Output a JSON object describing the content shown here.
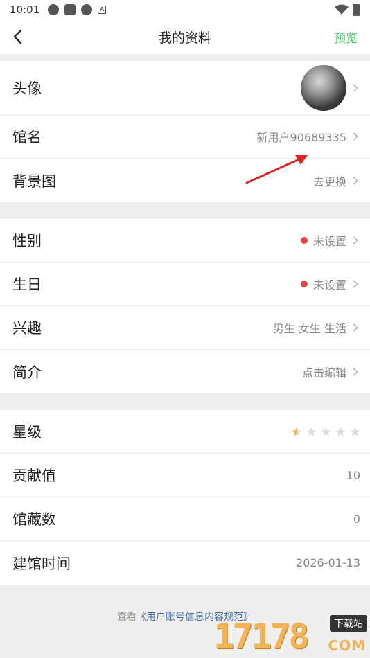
{
  "status_bar": {
    "time": "10:01"
  },
  "header": {
    "title": "我的资料",
    "preview_label": "预览"
  },
  "group1": {
    "avatar_label": "头像",
    "name_label": "馆名",
    "name_value": "新用户90689335",
    "background_label": "背景图",
    "background_value": "去更换"
  },
  "group2": {
    "gender_label": "性别",
    "gender_value": "未设置",
    "birthday_label": "生日",
    "birthday_value": "未设置",
    "interest_label": "兴趣",
    "interest_value": "男生 女生 生活",
    "intro_label": "简介",
    "intro_value": "点击编辑"
  },
  "group3": {
    "level_label": "星级",
    "level_stars": 0.5,
    "level_max": 5,
    "contribution_label": "贡献值",
    "contribution_value": "10",
    "collection_label": "馆藏数",
    "collection_value": "0",
    "founded_label": "建馆时间",
    "founded_value": "2026-01-13"
  },
  "footer": {
    "prefix": "查看",
    "link": "《用户账号信息内容规范》"
  },
  "watermark": {
    "number": "17178",
    "tag": "下载站",
    "domain": "COM"
  },
  "colors": {
    "accent_green": "#2fc058",
    "dot_red": "#f04141",
    "star_gold": "#f5b831",
    "star_grey": "#dddddd"
  }
}
